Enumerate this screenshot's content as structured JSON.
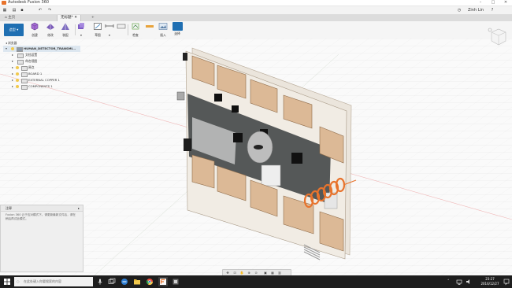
{
  "window": {
    "title": "Autodesk Fusion 360",
    "user": "Zinh Lin"
  },
  "tabs": [
    {
      "label": "主页"
    },
    {
      "label": "无标题*"
    }
  ],
  "workspace": {
    "label": "造型"
  },
  "toolbar": [
    {
      "label": "创建",
      "icon": "create-box-icon"
    },
    {
      "label": "修改",
      "icon": "modify-icon"
    },
    {
      "label": "装配",
      "icon": "assemble-icon"
    },
    {
      "label": "草图",
      "icon": "sketch-icon"
    },
    {
      "label": "检查",
      "icon": "inspect-icon"
    },
    {
      "label": "插入",
      "icon": "insert-image-icon"
    },
    {
      "label": "选择",
      "icon": "select-icon"
    }
  ],
  "browser": {
    "title": "浏览器",
    "items": [
      {
        "label": "HUMAN_DETECTOR_TRANSMI..."
      },
      {
        "label": "文档设置"
      },
      {
        "label": "命名视图"
      },
      {
        "label": "原点"
      },
      {
        "label": "BOARD 1"
      },
      {
        "label": "EXTERNAL COPPER 1"
      },
      {
        "label": "COMPONENTS 1"
      }
    ]
  },
  "comments": {
    "title": "注释",
    "message": "Fusion 360 云于应对模式下。请更新最新文件后，请在稍后再试此模式。"
  },
  "taskbar": {
    "search_placeholder": "在此处键入你要搜索的内容",
    "time": "23:27",
    "date": "2016/12/27"
  },
  "colors": {
    "accent": "#1f6fb2",
    "board_panel": "#e9e3da",
    "connector": "#d8b58f",
    "pcb_dark": "#2f3232",
    "coil": "#e8732c"
  }
}
